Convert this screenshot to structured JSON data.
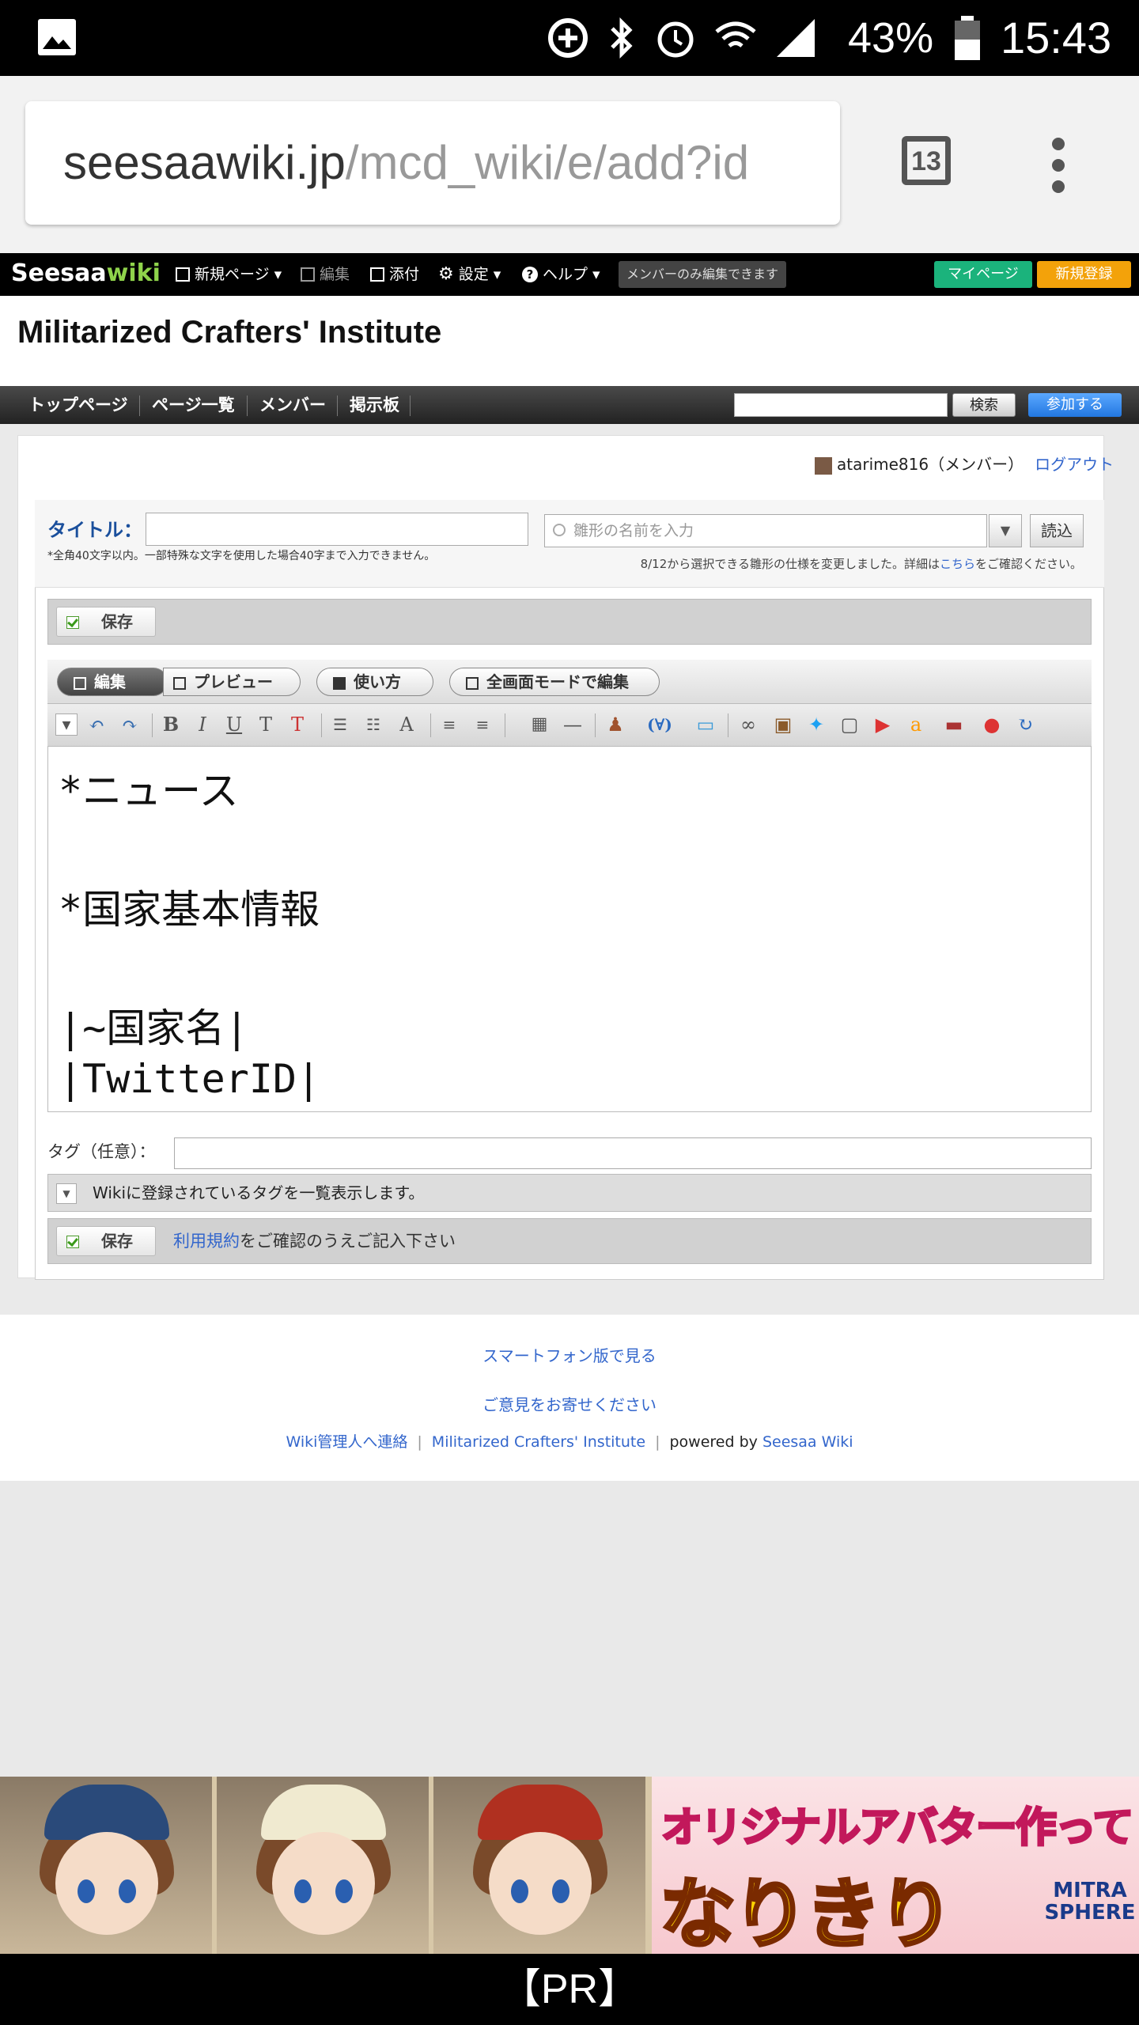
{
  "status_bar": {
    "battery_pct": "43%",
    "time": "15:43"
  },
  "browser": {
    "url_domain": "seesaawiki.jp",
    "url_path": "/mcd_wiki/e/add?id",
    "tab_count": "13"
  },
  "seesaa_header": {
    "logo_main": "Seesaa",
    "logo_wiki": "wiki",
    "menu": {
      "new_page": "新規ページ",
      "edit": "編集",
      "attach": "添付",
      "settings": "設定",
      "help": "ヘルプ"
    },
    "member_only": "メンバーのみ編集できます",
    "my_page": "マイページ",
    "register": "新規登録"
  },
  "site": {
    "title": "Militarized Crafters' Institute"
  },
  "nav": {
    "items": [
      "トップページ",
      "ページ一覧",
      "メンバー",
      "掲示板"
    ],
    "search_button": "検索",
    "join_button": "参加する"
  },
  "user": {
    "name": "atarime816（メンバー）",
    "logout": "ログアウト"
  },
  "form": {
    "title_label": "タイトル：",
    "title_hint": "*全角40文字以内。一部特殊な文字を使用した場合40字まで入力できません。",
    "template_placeholder": "雛形の名前を入力",
    "template_dropdown": "▼",
    "read_button": "読込",
    "template_note_pre": "8/12から選択できる雛形の仕様を変更しました。詳細は",
    "template_note_link": "こちら",
    "template_note_post": "をご確認ください。",
    "save_label": "保存",
    "mode_edit": "編集",
    "mode_preview": "プレビュー",
    "mode_howto": "使い方",
    "mode_fullscreen": "全画面モードで編集",
    "editor_lines": [
      "*ニュース",
      "",
      "*国家基本情報",
      "",
      "|~国家名|",
      "|TwitterID|"
    ],
    "tag_label": "タグ（任意）：",
    "tag_list_toggle": "Wikiに登録されているタグを一覧表示します。",
    "terms_link": "利用規約",
    "terms_text": "をご確認のうえご記入下さい"
  },
  "footer": {
    "smartphone": "スマートフォン版で見る",
    "feedback": "ご意見をお寄せください",
    "contact": "Wiki管理人へ連絡",
    "site_link": "Militarized Crafters' Institute",
    "powered_by": "powered by",
    "seesaa_link": "Seesaa Wiki"
  },
  "ad": {
    "line1": "オリジナルアバター作って",
    "line2": "なりきり",
    "brand": "MITRA SPHERE",
    "pr": "【PR】"
  }
}
